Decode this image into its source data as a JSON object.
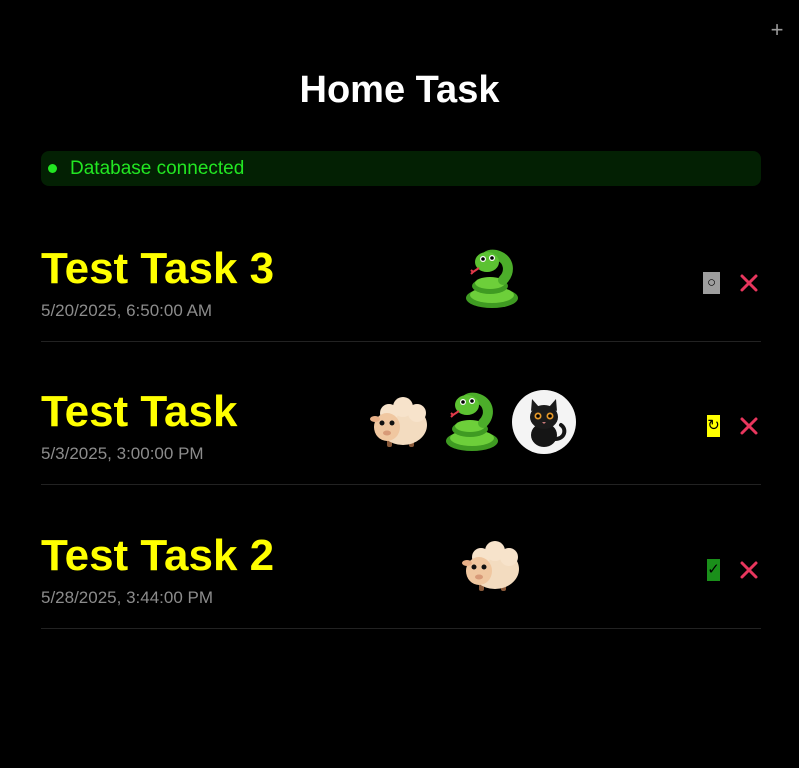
{
  "header": {
    "add_label": "+",
    "title": "Home Task"
  },
  "status": {
    "text": "Database connected",
    "color": "#22e622"
  },
  "tasks": [
    {
      "name": "Test Task 3",
      "date": "5/20/2025, 6:50:00 AM",
      "avatars": [
        "snake"
      ],
      "state": "pending",
      "state_icon": "○",
      "state_color": "#9e9e9e"
    },
    {
      "name": "Test Task",
      "date": "5/3/2025, 3:00:00 PM",
      "avatars": [
        "sheep",
        "snake",
        "black-cat"
      ],
      "state": "in-progress",
      "state_icon": "↻",
      "state_color": "#ffff00"
    },
    {
      "name": "Test Task 2",
      "date": "5/28/2025, 3:44:00 PM",
      "avatars": [
        "sheep"
      ],
      "state": "done",
      "state_icon": "✓",
      "state_color": "#1a8f1a"
    }
  ],
  "colors": {
    "task_name": "#ffff00",
    "delete": "#e8365d"
  }
}
